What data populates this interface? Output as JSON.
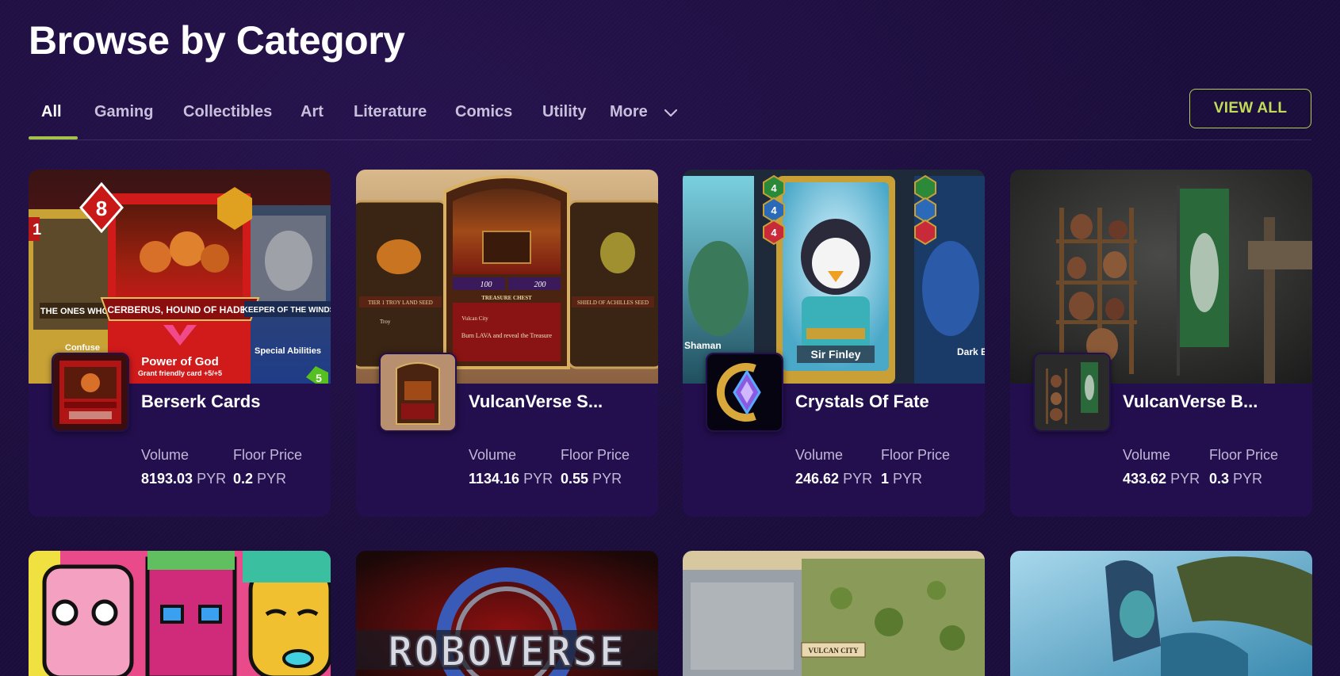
{
  "page": {
    "title": "Browse by Category"
  },
  "tabs": [
    {
      "label": "All"
    },
    {
      "label": "Gaming"
    },
    {
      "label": "Collectibles"
    },
    {
      "label": "Art"
    },
    {
      "label": "Literature"
    },
    {
      "label": "Comics"
    },
    {
      "label": "Utility"
    },
    {
      "label": "More"
    }
  ],
  "active_tab": "All",
  "view_all_label": "VIEW ALL",
  "cards": [
    {
      "name": "Berserk Cards",
      "volume_label": "Volume",
      "floor_label": "Floor Price",
      "volume_value": "8193.03",
      "floor_value": "0.2",
      "unit": "PYR",
      "banner_texts": [
        "THE ONES WHO",
        "CERBERUS, HOUND OF HADES",
        "KEEPER OF THE WINDS",
        "Power of God",
        "Grant friendly card +5/+5",
        "Confuse",
        "Special Abilities",
        "8",
        "1",
        "5"
      ]
    },
    {
      "name": "VulcanVerse S...",
      "volume_label": "Volume",
      "floor_label": "Floor Price",
      "volume_value": "1134.16",
      "floor_value": "0.55",
      "unit": "PYR",
      "banner_texts": [
        "TREASURE CHEST",
        "Burn LAVA and reveal the Treasure",
        "TIER 1 TROY LAND SEED",
        "SHIELD OF ACHILLES SEED",
        "Vulcan City",
        "Troy",
        "100",
        "200"
      ]
    },
    {
      "name": "Crystals Of Fate",
      "volume_label": "Volume",
      "floor_label": "Floor Price",
      "volume_value": "246.62",
      "floor_value": "1",
      "unit": "PYR",
      "banner_texts": [
        "Shaman",
        "Sir Finley",
        "Dark E",
        "4",
        "4",
        "4"
      ]
    },
    {
      "name": "VulcanVerse B...",
      "volume_label": "Volume",
      "floor_label": "Floor Price",
      "volume_value": "433.62",
      "floor_value": "0.3",
      "unit": "PYR",
      "banner_texts": []
    }
  ],
  "row2_texts": [
    "ROBOVERSE",
    "VULCAN CITY"
  ],
  "colors": {
    "background": "#1b0d3c",
    "card": "#230f4e",
    "accent": "#b5cf52",
    "muted_text": "#c0b8d6"
  }
}
